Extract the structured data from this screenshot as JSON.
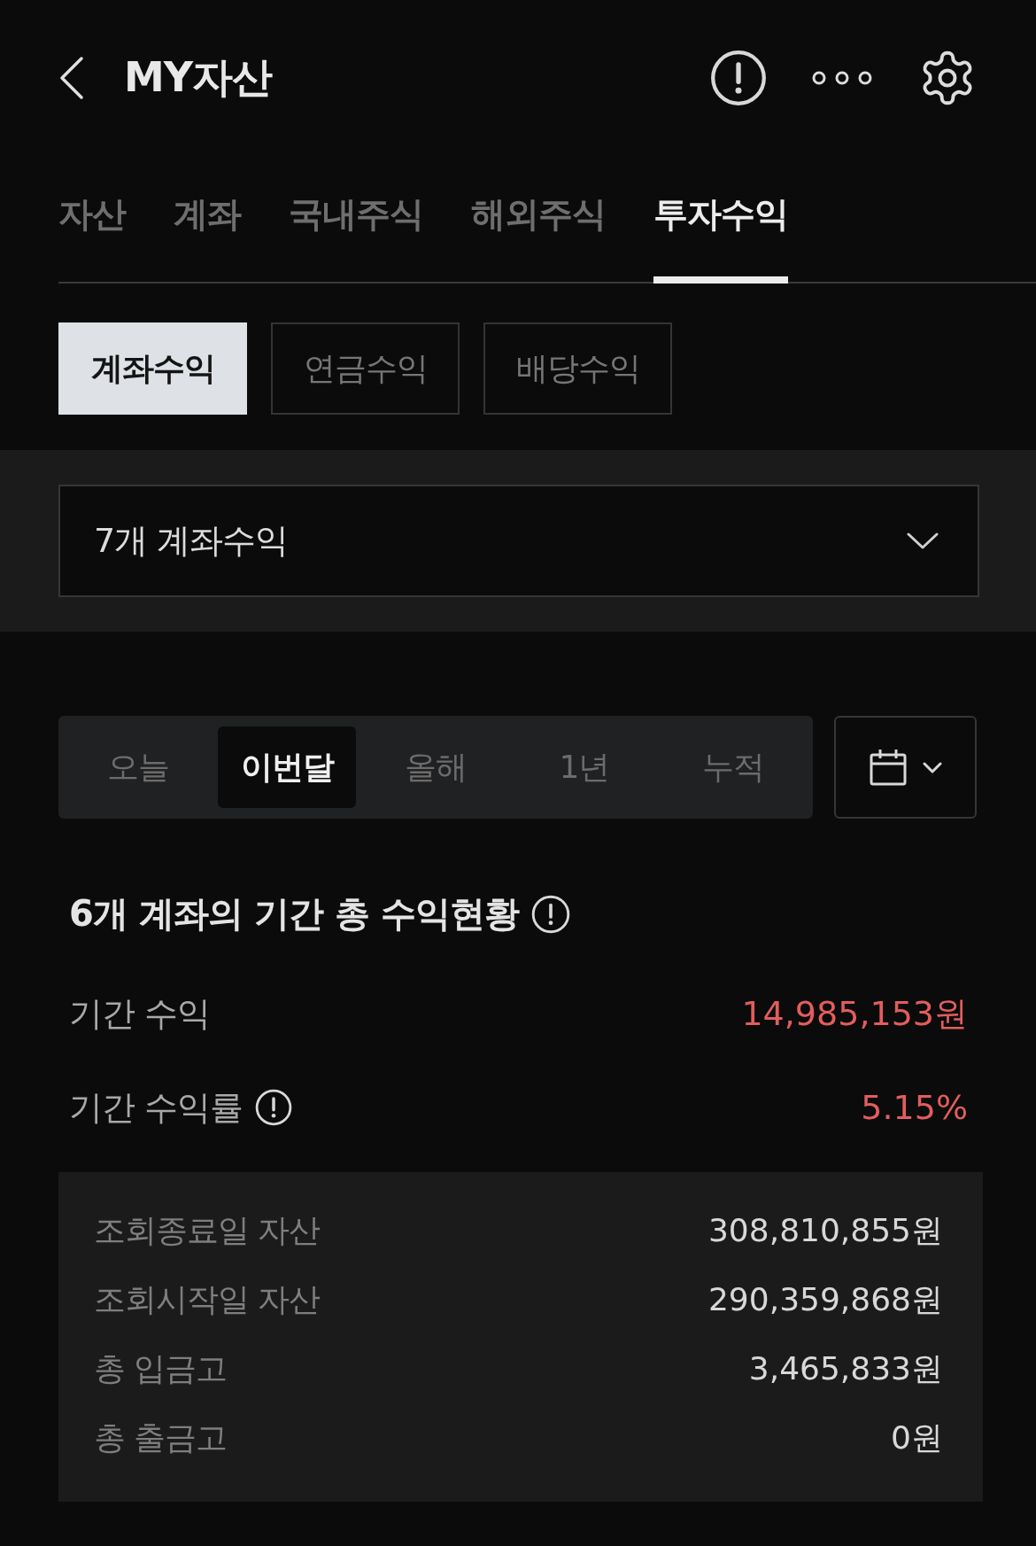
{
  "header": {
    "title": "MY자산"
  },
  "tabs": [
    {
      "label": "자산",
      "selected": false
    },
    {
      "label": "계좌",
      "selected": false
    },
    {
      "label": "국내주식",
      "selected": false
    },
    {
      "label": "해외주식",
      "selected": false
    },
    {
      "label": "투자수익",
      "selected": true
    }
  ],
  "sub_tabs": [
    {
      "label": "계좌수익",
      "selected": true
    },
    {
      "label": "연금수익",
      "selected": false
    },
    {
      "label": "배당수익",
      "selected": false
    }
  ],
  "account_select": {
    "value": "7개 계좌수익"
  },
  "periods": [
    {
      "label": "오늘",
      "selected": false
    },
    {
      "label": "이번달",
      "selected": true
    },
    {
      "label": "올해",
      "selected": false
    },
    {
      "label": "1년",
      "selected": false
    },
    {
      "label": "누적",
      "selected": false
    }
  ],
  "summary": {
    "title": "6개 계좌의 기간 총 수익현황",
    "rows": [
      {
        "label": "기간 수익",
        "value": "14,985,153원",
        "info": false
      },
      {
        "label": "기간 수익률",
        "value": "5.15%",
        "info": true
      }
    ]
  },
  "details": [
    {
      "label": "조회종료일 자산",
      "value": "308,810,855원"
    },
    {
      "label": "조회시작일 자산",
      "value": "290,359,868원"
    },
    {
      "label": "총 입금고",
      "value": "3,465,833원"
    },
    {
      "label": "총 출금고",
      "value": "0원"
    }
  ]
}
